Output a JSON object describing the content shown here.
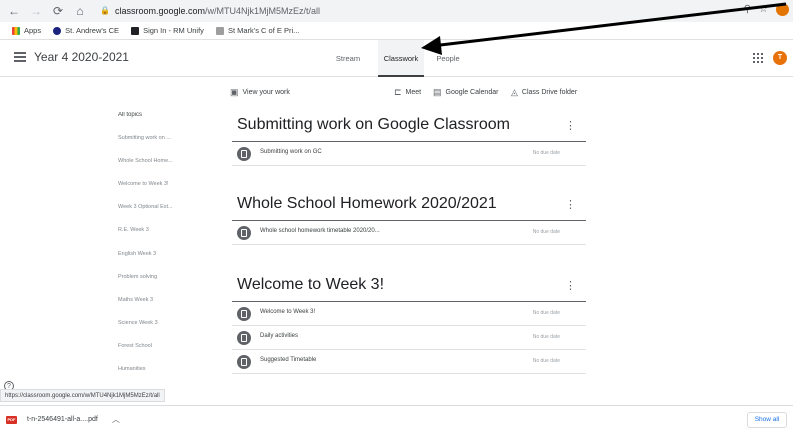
{
  "browser": {
    "url_host": "classroom.google.com",
    "url_path": "/w/MTU4Njk1MjM5MzEz/t/all",
    "status_url": "https://classroom.google.com/w/MTU4Njk1MjM5MzEz/t/all"
  },
  "bookmarks": [
    {
      "label": "Apps",
      "icon": "apps-grid-icon",
      "color": "#ea4335"
    },
    {
      "label": "St. Andrew's CE",
      "icon": "school-icon",
      "color": "#1a237e"
    },
    {
      "label": "Sign In - RM Unify",
      "icon": "rm-icon",
      "color": "#202124"
    },
    {
      "label": "St Mark's C of E Pri...",
      "icon": "school-crest-icon",
      "color": "#9e9e9e"
    }
  ],
  "header": {
    "class_title": "Year 4 2020-2021",
    "avatar_letter": "T",
    "tabs": [
      {
        "label": "Stream",
        "active": false
      },
      {
        "label": "Classwork",
        "active": true
      },
      {
        "label": "People",
        "active": false
      }
    ]
  },
  "actions": {
    "view_work": "View your work",
    "meet": "Meet",
    "calendar": "Google Calendar",
    "drive": "Class Drive folder"
  },
  "sidebar": {
    "items": [
      "All topics",
      "Submitting work on ...",
      "Whole School Home...",
      "Welcome to Week 3!",
      "Week 3 Optional Ext...",
      "R.E. Week 3",
      "English Week 3",
      "Problem solving",
      "Maths Week 3",
      "Science Week 3",
      "Forest School",
      "Humanities"
    ]
  },
  "sections": [
    {
      "title": "Submitting work on Google Classroom",
      "rows": [
        {
          "text": "Submitting work on GC",
          "due": "No due date"
        }
      ]
    },
    {
      "title": "Whole School Homework 2020/2021",
      "rows": [
        {
          "text": "Whole school homework timetable 2020/20...",
          "due": "No due date"
        }
      ]
    },
    {
      "title": "Welcome to Week 3!",
      "rows": [
        {
          "text": "Welcome to Week 3!",
          "due": "No due date"
        },
        {
          "text": "Daily activities",
          "due": "No due date"
        },
        {
          "text": "Suggested Timetable",
          "due": "No due date"
        }
      ]
    }
  ],
  "download": {
    "file_name": "t-n-2546491-all-a....pdf",
    "file_type": "PDF",
    "show_all": "Show all"
  }
}
